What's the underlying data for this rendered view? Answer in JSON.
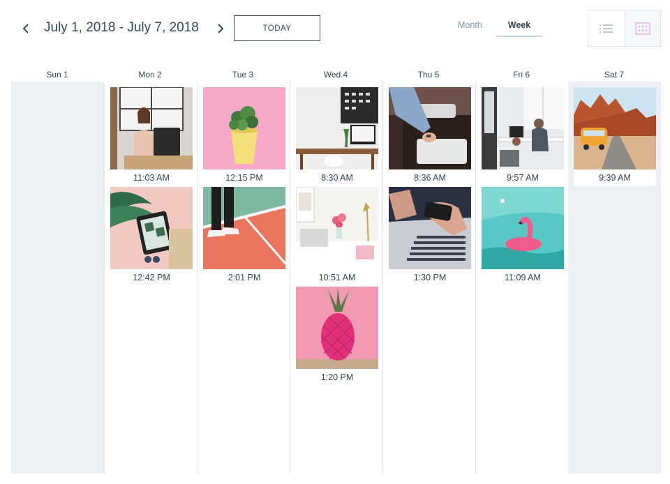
{
  "header": {
    "date_range": "July 1, 2018 - July 7, 2018",
    "today_label": "TODAY",
    "views": {
      "month": "Month",
      "week": "Week"
    },
    "active_view": "Week"
  },
  "days": [
    {
      "label": "Sun 1",
      "posts": []
    },
    {
      "label": "Mon 2",
      "posts": [
        {
          "time": "11:03 AM",
          "image": "woman-laptop-office"
        },
        {
          "time": "12:42 PM",
          "image": "tablet-palm-leaves"
        }
      ]
    },
    {
      "label": "Tue 3",
      "posts": [
        {
          "time": "12:15 PM",
          "image": "potted-plant-pink"
        },
        {
          "time": "2:01 PM",
          "image": "sneakers-court"
        }
      ]
    },
    {
      "label": "Wed 4",
      "posts": [
        {
          "time": "8:30 AM",
          "image": "desk-chalkboard"
        },
        {
          "time": "10:51 AM",
          "image": "desk-flowers-lamp"
        },
        {
          "time": "1:20 PM",
          "image": "pineapple-pink"
        }
      ]
    },
    {
      "label": "Thu 5",
      "posts": [
        {
          "time": "8:36 AM",
          "image": "hands-scanner"
        },
        {
          "time": "1:30 PM",
          "image": "phone-laptop"
        }
      ]
    },
    {
      "label": "Fri 6",
      "posts": [
        {
          "time": "9:57 AM",
          "image": "office-workers"
        },
        {
          "time": "11:09 AM",
          "image": "flamingo-float"
        }
      ]
    },
    {
      "label": "Sat 7",
      "posts": [
        {
          "time": "9:39 AM",
          "image": "van-desert"
        }
      ]
    }
  ],
  "colors": {
    "text": "#33475b",
    "muted": "#7c98b6",
    "grid_bg": "#eaf0f4",
    "border": "#dfe3eb",
    "accent": "#e66e50"
  },
  "icons": {
    "prev": "chevron-left-icon",
    "next": "chevron-right-icon",
    "list": "list-view-icon",
    "grid": "grid-view-icon"
  }
}
